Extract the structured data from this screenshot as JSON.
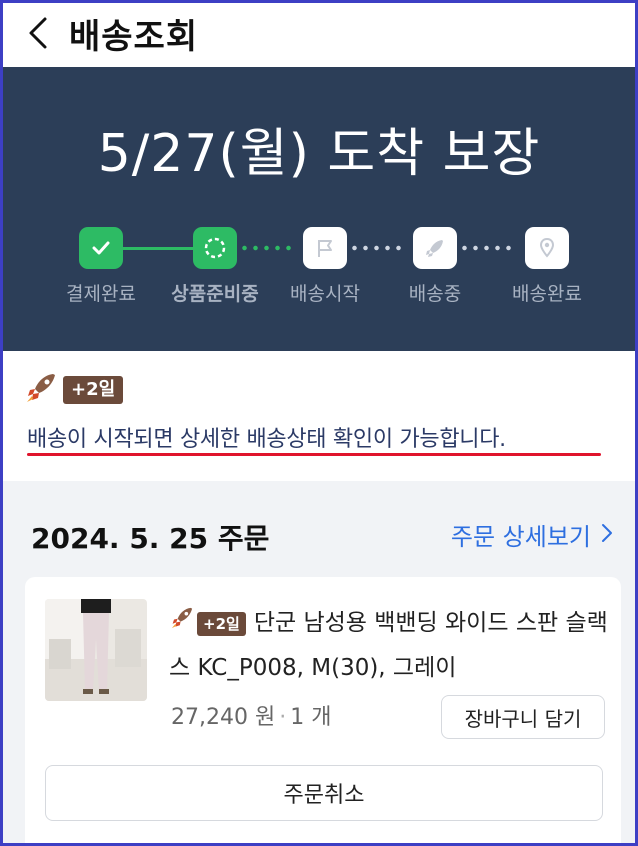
{
  "header": {
    "title": "배송조회",
    "back_icon": "chevron-left-icon"
  },
  "hero": {
    "title": "5/27(월) 도착 보장",
    "steps": [
      {
        "label": "결제완료",
        "state": "done",
        "icon": "check-icon"
      },
      {
        "label": "상품준비중",
        "state": "current",
        "icon": "loading-ring-icon"
      },
      {
        "label": "배송시작",
        "state": "todo",
        "icon": "flag-icon"
      },
      {
        "label": "배송중",
        "state": "todo",
        "icon": "rocket-icon"
      },
      {
        "label": "배송완료",
        "state": "todo",
        "icon": "location-pin-icon"
      }
    ]
  },
  "notice": {
    "badge": "+2일",
    "text": "배송이 시작되면 상세한 배송상태 확인이 가능합니다."
  },
  "order": {
    "date": "2024. 5. 25 주문",
    "detail_link": "주문 상세보기",
    "item": {
      "badge": "+2일",
      "name": "단군 남성용 백밴딩 와이드 스판 슬랙스 KC_P008, M(30), 그레이",
      "price": "27,240 원",
      "qty": "1 개",
      "cart_button": "장바구니 담기"
    },
    "cancel_button": "주문취소"
  },
  "colors": {
    "hero_bg": "#2c3e58",
    "green": "#2dbb64",
    "link": "#2e6fe0",
    "underline": "#e0142c",
    "badge": "#6b4a3a"
  }
}
